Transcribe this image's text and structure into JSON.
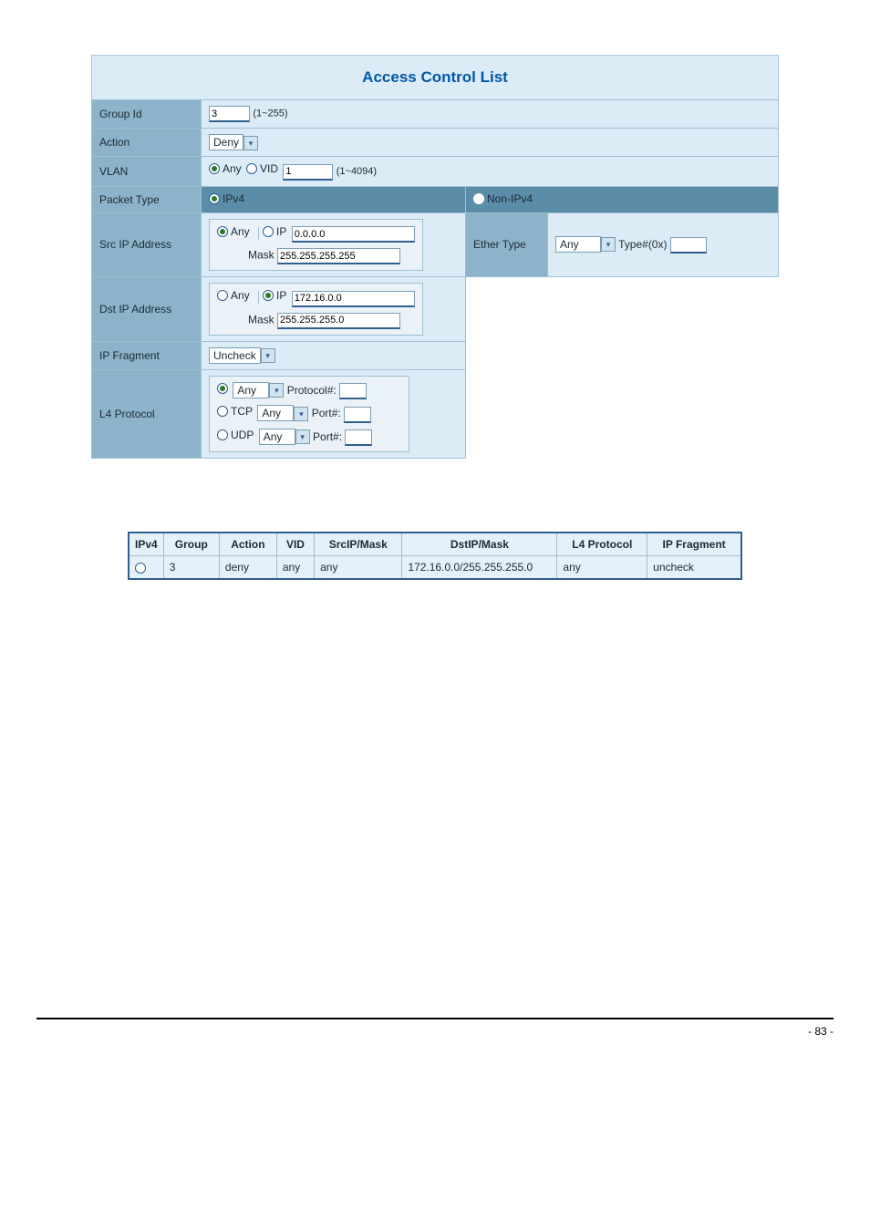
{
  "title": "Access Control List",
  "labels": {
    "group_id": "Group Id",
    "action": "Action",
    "vlan": "VLAN",
    "packet_type": "Packet Type",
    "src_ip": "Src IP Address",
    "dst_ip": "Dst IP Address",
    "ip_fragment": "IP Fragment",
    "l4_protocol": "L4 Protocol",
    "ether_type": "Ether Type",
    "any": "Any",
    "ip": "IP",
    "vid": "VID",
    "ipv4": "IPv4",
    "non_ipv4": "Non-IPv4",
    "mask": "Mask",
    "tcp": "TCP",
    "udp": "UDP",
    "protocol_num": "Protocol#:",
    "port_num": "Port#:",
    "type_hex": "Type#(0x)"
  },
  "values": {
    "group_id": "3",
    "group_id_hint": "(1~255)",
    "action": "Deny",
    "vlan_vid": "1",
    "vlan_hint": "(1~4094)",
    "src_ip": "0.0.0.0",
    "src_mask": "255.255.255.255",
    "dst_ip": "172.16.0.0",
    "dst_mask": "255.255.255.0",
    "ip_fragment": "Uncheck",
    "l4_any": "Any",
    "l4_tcp": "Any",
    "l4_udp": "Any",
    "ether_any": "Any",
    "protocol_num": "",
    "tcp_port": "",
    "udp_port": "",
    "type_hex": ""
  },
  "result_headers": {
    "ipv4": "IPv4",
    "group": "Group",
    "action": "Action",
    "vid": "VID",
    "srcip": "SrcIP/Mask",
    "dstip": "DstIP/Mask",
    "l4": "L4 Protocol",
    "frag": "IP Fragment"
  },
  "result_row": {
    "group": "3",
    "action": "deny",
    "vid": "any",
    "srcip": "any",
    "dstip": "172.16.0.0/255.255.255.0",
    "l4": "any",
    "frag": "uncheck"
  },
  "page_number": "- 83 -"
}
